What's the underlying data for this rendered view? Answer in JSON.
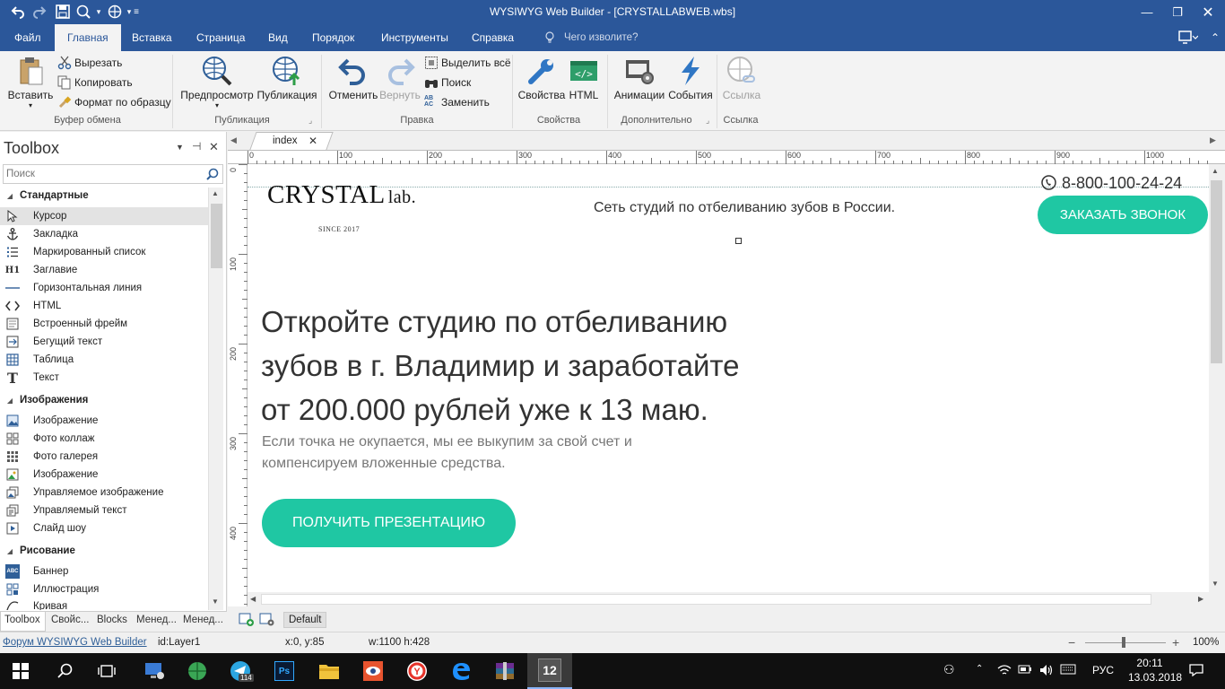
{
  "window": {
    "title": "WYSIWYG Web Builder - [CRYSTALLABWEB.wbs]"
  },
  "menu": {
    "tabs": [
      {
        "label": "Файл"
      },
      {
        "label": "Главная"
      },
      {
        "label": "Вставка"
      },
      {
        "label": "Страница"
      },
      {
        "label": "Вид"
      },
      {
        "label": "Порядок"
      },
      {
        "label": "Инструменты"
      },
      {
        "label": "Справка"
      }
    ],
    "tell_me": "Чего изволите?"
  },
  "ribbon": {
    "clipboard": {
      "paste": "Вставить",
      "cut": "Вырезать",
      "copy": "Копировать",
      "format_painter": "Формат по образцу",
      "group": "Буфер обмена"
    },
    "publish": {
      "preview": "Предпросмотр",
      "publish": "Публикация",
      "group": "Публикация"
    },
    "edit": {
      "undo": "Отменить",
      "redo": "Вернуть",
      "select_all": "Выделить всё",
      "find": "Поиск",
      "replace": "Заменить",
      "group": "Правка"
    },
    "properties": {
      "properties": "Свойства",
      "html": "HTML",
      "group": "Свойства"
    },
    "extra": {
      "animations": "Анимации",
      "events": "События",
      "group": "Дополнительно"
    },
    "link": {
      "link": "Ссылка",
      "group": "Ссылка"
    }
  },
  "toolbox": {
    "title": "Toolbox",
    "search_placeholder": "Поиск",
    "categories": [
      {
        "label": "Стандартные"
      },
      {
        "label": "Изображения"
      },
      {
        "label": "Рисование"
      }
    ],
    "standard_items": [
      {
        "label": "Курсор",
        "icon": "cursor-icon"
      },
      {
        "label": "Закладка",
        "icon": "anchor-icon"
      },
      {
        "label": "Маркированный список",
        "icon": "bullet-list-icon"
      },
      {
        "label": "Заглавие",
        "icon": "heading-icon",
        "glyph": "H1"
      },
      {
        "label": "Горизонтальная линия",
        "icon": "hr-icon"
      },
      {
        "label": "HTML",
        "icon": "code-icon"
      },
      {
        "label": "Встроенный фрейм",
        "icon": "iframe-icon"
      },
      {
        "label": "Бегущий текст",
        "icon": "marquee-icon"
      },
      {
        "label": "Таблица",
        "icon": "table-icon"
      },
      {
        "label": "Текст",
        "icon": "text-icon",
        "glyph": "T"
      }
    ],
    "image_items": [
      {
        "label": "Изображение",
        "icon": "image-icon"
      },
      {
        "label": "Фото коллаж",
        "icon": "photo-collage-icon"
      },
      {
        "label": "Фото галерея",
        "icon": "photo-gallery-icon"
      },
      {
        "label": "Изображение",
        "icon": "image-alt-icon"
      },
      {
        "label": "Управляемое изображение",
        "icon": "managed-image-icon"
      },
      {
        "label": "Управляемый текст",
        "icon": "managed-text-icon"
      },
      {
        "label": "Слайд шоу",
        "icon": "slideshow-icon"
      }
    ],
    "drawing_items": [
      {
        "label": "Баннер",
        "icon": "banner-icon",
        "glyph": "ABC"
      },
      {
        "label": "Иллюстрация",
        "icon": "illustration-icon"
      },
      {
        "label": "Кривая",
        "icon": "curve-icon"
      }
    ],
    "bottom_tabs": [
      {
        "label": "Toolbox"
      },
      {
        "label": "Свойс..."
      },
      {
        "label": "Blocks"
      },
      {
        "label": "Менед..."
      },
      {
        "label": "Менед..."
      }
    ]
  },
  "document": {
    "tab": "index",
    "ruler_labels": [
      "0",
      "100",
      "200",
      "300",
      "400",
      "500",
      "600",
      "700",
      "800",
      "900",
      "1000"
    ],
    "vruler_labels": [
      "0",
      "100",
      "200",
      "300",
      "400"
    ],
    "layer_tab": "Default"
  },
  "page": {
    "logo_main": "CRYSTAL",
    "logo_suffix": "lab.",
    "logo_since": "SINCE 2017",
    "tagline": "Сеть студий по отбеливанию зубов в России.",
    "phone": "8-800-100-24-24",
    "call_button": "ЗАКАЗАТЬ ЗВОНОК",
    "headline_1": "Откройте студию по отбеливанию",
    "headline_2": "зубов в г. Владимир и заработайте",
    "headline_3": "от 200.000 рублей уже к 13 маю.",
    "sub_1": "Если точка не окупается, мы ее выкупим за свой счет и",
    "sub_2": "компенсируем вложенные средства.",
    "cta_button": "ПОЛУЧИТЬ ПРЕЗЕНТАЦИЮ",
    "accent_color": "#1fc7a3"
  },
  "status": {
    "forum_link": "Форум WYSIWYG Web Builder",
    "id": "id:Layer1",
    "pos": "x:0, y:85",
    "size": "w:1100 h:428",
    "zoom": "100%"
  },
  "taskbar": {
    "lang": "РУС",
    "time": "20:11",
    "date": "13.03.2018",
    "telegram_badge": "114",
    "wb_label": "12"
  }
}
